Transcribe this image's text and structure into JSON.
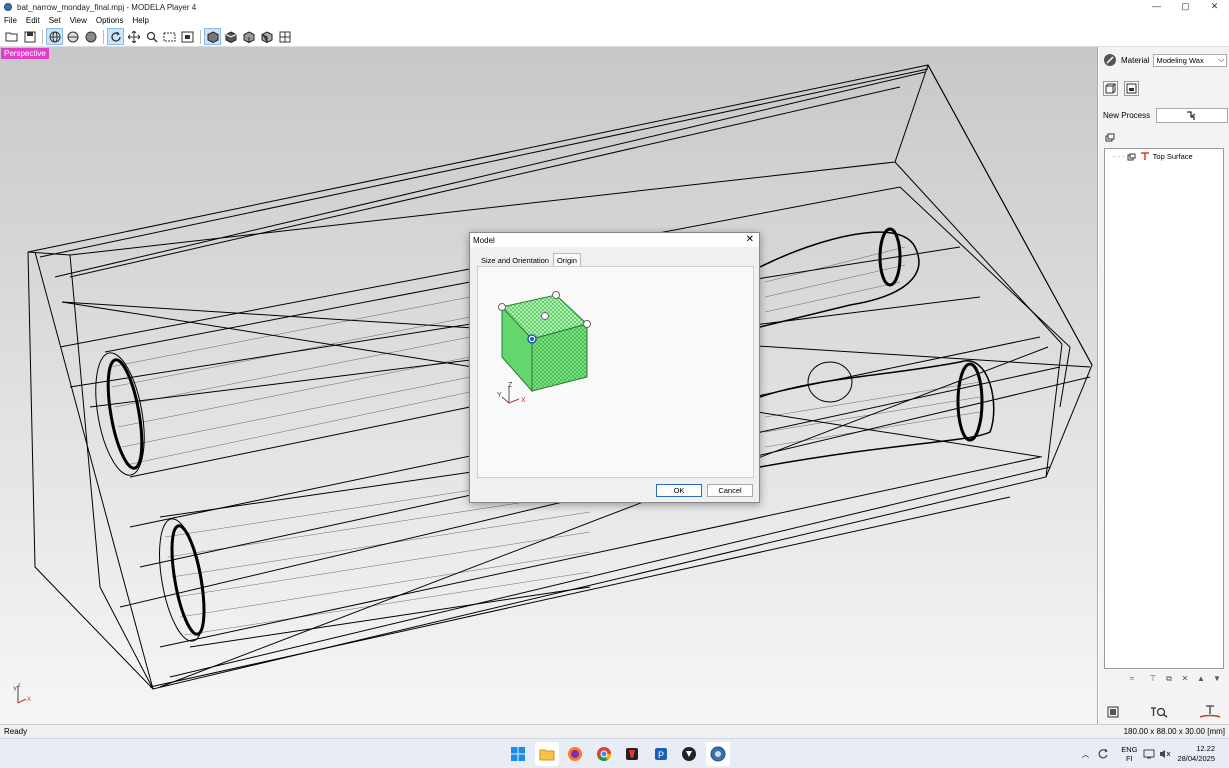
{
  "window": {
    "title": "bat_narrow_monday_final.mpj - MODELA Player 4",
    "minimize": "—",
    "maximize": "▢",
    "close": "✕"
  },
  "menu": [
    "File",
    "Edit",
    "Set",
    "View",
    "Options",
    "Help"
  ],
  "viewport": {
    "view_label": "Perspective",
    "axis_y": "Y",
    "axis_z": "Z",
    "axis_x": "X"
  },
  "right_panel": {
    "material_label": "Material",
    "material_value": "Modeling Wax",
    "new_process_label": "New Process",
    "tree_item": "Top Surface"
  },
  "status": {
    "left": "Ready",
    "right": "180.00 x 88.00 x 30.00 [mm]"
  },
  "dialog": {
    "title": "Model",
    "close": "✕",
    "tabs": [
      "Size and Orientation",
      "Origin"
    ],
    "selected_tab": 1,
    "axis_y": "Y",
    "axis_z": "Z",
    "axis_x": "X",
    "ok": "OK",
    "cancel": "Cancel"
  },
  "taskbar": {
    "lang_top": "ENG",
    "lang_bottom": "FI",
    "time": "12.22",
    "date": "28/04/2025"
  },
  "colors": {
    "perspective_badge": "#e040c8",
    "cube_green": "#5fd36a",
    "origin_blue": "#1a5fb4"
  }
}
